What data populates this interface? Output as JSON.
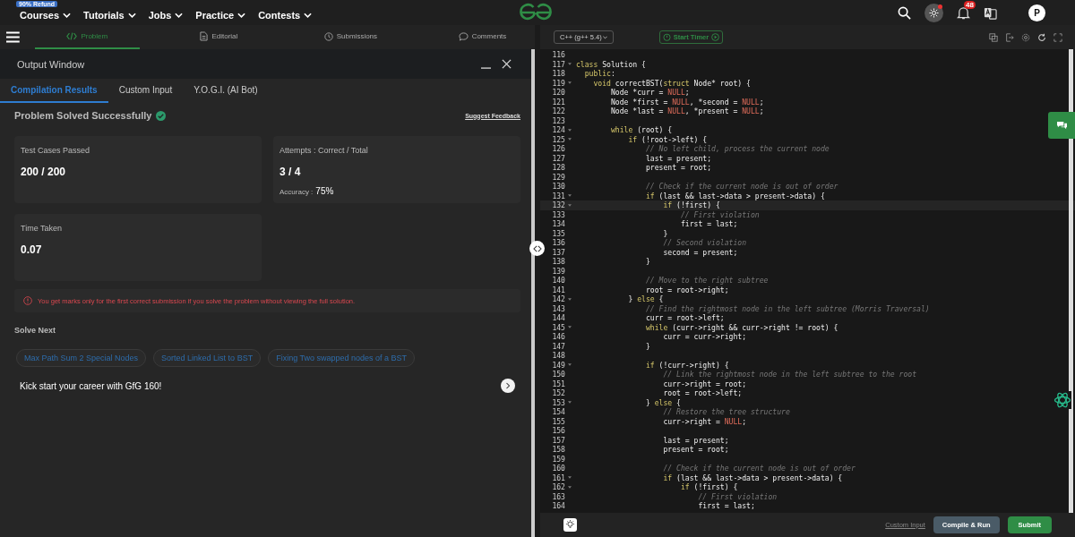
{
  "top_nav": {
    "badge": "90% Refund",
    "items": [
      "Courses",
      "Tutorials",
      "Jobs",
      "Practice",
      "Contests"
    ],
    "notifications": "48",
    "avatar": "P",
    "theme_dot": true
  },
  "problem_tabs": [
    {
      "label": "Problem",
      "selected": true
    },
    {
      "label": "Editorial",
      "selected": false
    },
    {
      "label": "Submissions",
      "selected": false
    },
    {
      "label": "Comments",
      "selected": false
    }
  ],
  "output_window": {
    "title": "Output Window",
    "tabs": [
      {
        "label": "Compilation Results",
        "selected": true
      },
      {
        "label": "Custom Input",
        "selected": false
      },
      {
        "label": "Y.O.G.I. (AI Bot)",
        "selected": false
      }
    ],
    "status": "Problem Solved Successfully",
    "feedback_link": "Suggest Feedback",
    "cards": [
      {
        "label": "Test Cases Passed",
        "value": "200 / 200"
      },
      {
        "label": "Attempts : Correct / Total",
        "value": "3 / 4",
        "extra_label": "Accuracy :",
        "extra_value": "75%"
      },
      {
        "label": "Time Taken",
        "value": "0.07"
      }
    ],
    "warning": "You get marks only for the first correct submission if you solve the problem without viewing the full solution.",
    "solve_next_title": "Solve Next",
    "solve_next": [
      "Max Path Sum 2 Special Nodes",
      "Sorted Linked List to BST",
      "Fixing Two swapped nodes of a BST"
    ],
    "promo": "Kick start your career with GfG 160!"
  },
  "editor": {
    "language": "C++ (g++ 5.4)",
    "timer_button": "Start Timer",
    "lines": [
      {
        "number": "116",
        "fold": false,
        "current": false
      },
      {
        "number": "117",
        "fold": true,
        "current": false,
        "tokens": [
          {
            "kind": "kw",
            "text": "class"
          },
          {
            "kind": "plain",
            "text": " Solution {"
          }
        ]
      },
      {
        "number": "118",
        "fold": false,
        "current": false,
        "tokens": [
          {
            "kind": "kw",
            "text": "  public"
          },
          {
            "kind": "plain",
            "text": ":"
          }
        ]
      },
      {
        "number": "119",
        "fold": true,
        "current": false,
        "tokens": [
          {
            "kind": "kw",
            "text": "    void"
          },
          {
            "kind": "plain",
            "text": " correctBST("
          },
          {
            "kind": "kw",
            "text": "struct"
          },
          {
            "kind": "plain",
            "text": " Node* root) {"
          }
        ]
      },
      {
        "number": "120",
        "fold": false,
        "current": false,
        "tokens": [
          {
            "kind": "plain",
            "text": "        Node *curr = "
          },
          {
            "kind": "null",
            "text": "NULL"
          },
          {
            "kind": "plain",
            "text": ";"
          }
        ]
      },
      {
        "number": "121",
        "fold": false,
        "current": false,
        "tokens": [
          {
            "kind": "plain",
            "text": "        Node *first = "
          },
          {
            "kind": "null",
            "text": "NULL"
          },
          {
            "kind": "plain",
            "text": ", *second = "
          },
          {
            "kind": "null",
            "text": "NULL"
          },
          {
            "kind": "plain",
            "text": ";"
          }
        ]
      },
      {
        "number": "122",
        "fold": false,
        "current": false,
        "tokens": [
          {
            "kind": "plain",
            "text": "        Node *last = "
          },
          {
            "kind": "null",
            "text": "NULL"
          },
          {
            "kind": "plain",
            "text": ", *present = "
          },
          {
            "kind": "null",
            "text": "NULL"
          },
          {
            "kind": "plain",
            "text": ";"
          }
        ]
      },
      {
        "number": "123",
        "fold": false,
        "current": false
      },
      {
        "number": "124",
        "fold": true,
        "current": false,
        "tokens": [
          {
            "kind": "kw",
            "text": "        while"
          },
          {
            "kind": "plain",
            "text": " (root) {"
          }
        ]
      },
      {
        "number": "125",
        "fold": true,
        "current": false,
        "tokens": [
          {
            "kind": "kw",
            "text": "            if"
          },
          {
            "kind": "plain",
            "text": " (!root->left) {"
          }
        ]
      },
      {
        "number": "126",
        "fold": false,
        "current": false,
        "tokens": [
          {
            "kind": "comment",
            "text": "                // No left child, process the current node"
          }
        ]
      },
      {
        "number": "127",
        "fold": false,
        "current": false,
        "tokens": [
          {
            "kind": "plain",
            "text": "                last = present;"
          }
        ]
      },
      {
        "number": "128",
        "fold": false,
        "current": false,
        "tokens": [
          {
            "kind": "plain",
            "text": "                present = root;"
          }
        ]
      },
      {
        "number": "129",
        "fold": false,
        "current": false
      },
      {
        "number": "130",
        "fold": false,
        "current": false,
        "tokens": [
          {
            "kind": "comment",
            "text": "                // Check if the current node is out of order"
          }
        ]
      },
      {
        "number": "131",
        "fold": true,
        "current": false,
        "tokens": [
          {
            "kind": "kw",
            "text": "                if"
          },
          {
            "kind": "plain",
            "text": " (last && last->data > present->data) {"
          }
        ]
      },
      {
        "number": "132",
        "fold": true,
        "current": true,
        "tokens": [
          {
            "kind": "kw",
            "text": "                    if"
          },
          {
            "kind": "plain",
            "text": " (!first) {"
          }
        ]
      },
      {
        "number": "133",
        "fold": false,
        "current": false,
        "tokens": [
          {
            "kind": "comment",
            "text": "                        // First violation"
          }
        ]
      },
      {
        "number": "134",
        "fold": false,
        "current": false,
        "tokens": [
          {
            "kind": "plain",
            "text": "                        first = last;"
          }
        ]
      },
      {
        "number": "135",
        "fold": false,
        "current": false,
        "tokens": [
          {
            "kind": "plain",
            "text": "                    }"
          }
        ]
      },
      {
        "number": "136",
        "fold": false,
        "current": false,
        "tokens": [
          {
            "kind": "comment",
            "text": "                    // Second violation"
          }
        ]
      },
      {
        "number": "137",
        "fold": false,
        "current": false,
        "tokens": [
          {
            "kind": "plain",
            "text": "                    second = present;"
          }
        ]
      },
      {
        "number": "138",
        "fold": false,
        "current": false,
        "tokens": [
          {
            "kind": "plain",
            "text": "                }"
          }
        ]
      },
      {
        "number": "139",
        "fold": false,
        "current": false
      },
      {
        "number": "140",
        "fold": false,
        "current": false,
        "tokens": [
          {
            "kind": "comment",
            "text": "                // Move to the right subtree"
          }
        ]
      },
      {
        "number": "141",
        "fold": false,
        "current": false,
        "tokens": [
          {
            "kind": "plain",
            "text": "                root = root->right;"
          }
        ]
      },
      {
        "number": "142",
        "fold": true,
        "current": false,
        "tokens": [
          {
            "kind": "plain",
            "text": "            } "
          },
          {
            "kind": "kw",
            "text": "else"
          },
          {
            "kind": "plain",
            "text": " {"
          }
        ]
      },
      {
        "number": "143",
        "fold": false,
        "current": false,
        "tokens": [
          {
            "kind": "comment",
            "text": "                // Find the rightmost node in the left subtree (Morris Traversal)"
          }
        ]
      },
      {
        "number": "144",
        "fold": false,
        "current": false,
        "tokens": [
          {
            "kind": "plain",
            "text": "                curr = root->left;"
          }
        ]
      },
      {
        "number": "145",
        "fold": true,
        "current": false,
        "tokens": [
          {
            "kind": "kw",
            "text": "                while"
          },
          {
            "kind": "plain",
            "text": " (curr->right && curr->right != root) {"
          }
        ]
      },
      {
        "number": "146",
        "fold": false,
        "current": false,
        "tokens": [
          {
            "kind": "plain",
            "text": "                    curr = curr->right;"
          }
        ]
      },
      {
        "number": "147",
        "fold": false,
        "current": false,
        "tokens": [
          {
            "kind": "plain",
            "text": "                }"
          }
        ]
      },
      {
        "number": "148",
        "fold": false,
        "current": false
      },
      {
        "number": "149",
        "fold": true,
        "current": false,
        "tokens": [
          {
            "kind": "kw",
            "text": "                if"
          },
          {
            "kind": "plain",
            "text": " (!curr->right) {"
          }
        ]
      },
      {
        "number": "150",
        "fold": false,
        "current": false,
        "tokens": [
          {
            "kind": "comment",
            "text": "                    // Link the rightmost node in the left subtree to the root"
          }
        ]
      },
      {
        "number": "151",
        "fold": false,
        "current": false,
        "tokens": [
          {
            "kind": "plain",
            "text": "                    curr->right = root;"
          }
        ]
      },
      {
        "number": "152",
        "fold": false,
        "current": false,
        "tokens": [
          {
            "kind": "plain",
            "text": "                    root = root->left;"
          }
        ]
      },
      {
        "number": "153",
        "fold": true,
        "current": false,
        "tokens": [
          {
            "kind": "plain",
            "text": "                } "
          },
          {
            "kind": "kw",
            "text": "else"
          },
          {
            "kind": "plain",
            "text": " {"
          }
        ]
      },
      {
        "number": "154",
        "fold": false,
        "current": false,
        "tokens": [
          {
            "kind": "comment",
            "text": "                    // Restore the tree structure"
          }
        ]
      },
      {
        "number": "155",
        "fold": false,
        "current": false,
        "tokens": [
          {
            "kind": "plain",
            "text": "                    curr->right = "
          },
          {
            "kind": "null",
            "text": "NULL"
          },
          {
            "kind": "plain",
            "text": ";"
          }
        ]
      },
      {
        "number": "156",
        "fold": false,
        "current": false
      },
      {
        "number": "157",
        "fold": false,
        "current": false,
        "tokens": [
          {
            "kind": "plain",
            "text": "                    last = present;"
          }
        ]
      },
      {
        "number": "158",
        "fold": false,
        "current": false,
        "tokens": [
          {
            "kind": "plain",
            "text": "                    present = root;"
          }
        ]
      },
      {
        "number": "159",
        "fold": false,
        "current": false
      },
      {
        "number": "160",
        "fold": false,
        "current": false,
        "tokens": [
          {
            "kind": "comment",
            "text": "                    // Check if the current node is out of order"
          }
        ]
      },
      {
        "number": "161",
        "fold": true,
        "current": false,
        "tokens": [
          {
            "kind": "kw",
            "text": "                    if"
          },
          {
            "kind": "plain",
            "text": " (last && last->data > present->data) {"
          }
        ]
      },
      {
        "number": "162",
        "fold": true,
        "current": false,
        "tokens": [
          {
            "kind": "kw",
            "text": "                        if"
          },
          {
            "kind": "plain",
            "text": " (!first) {"
          }
        ]
      },
      {
        "number": "163",
        "fold": false,
        "current": false,
        "tokens": [
          {
            "kind": "comment",
            "text": "                            // First violation"
          }
        ]
      },
      {
        "number": "164",
        "fold": false,
        "current": false,
        "tokens": [
          {
            "kind": "plain",
            "text": "                            first = last;"
          }
        ]
      }
    ],
    "custom_input_link": "Custom Input",
    "run_button": "Compile & Run",
    "submit_button": "Submit"
  }
}
